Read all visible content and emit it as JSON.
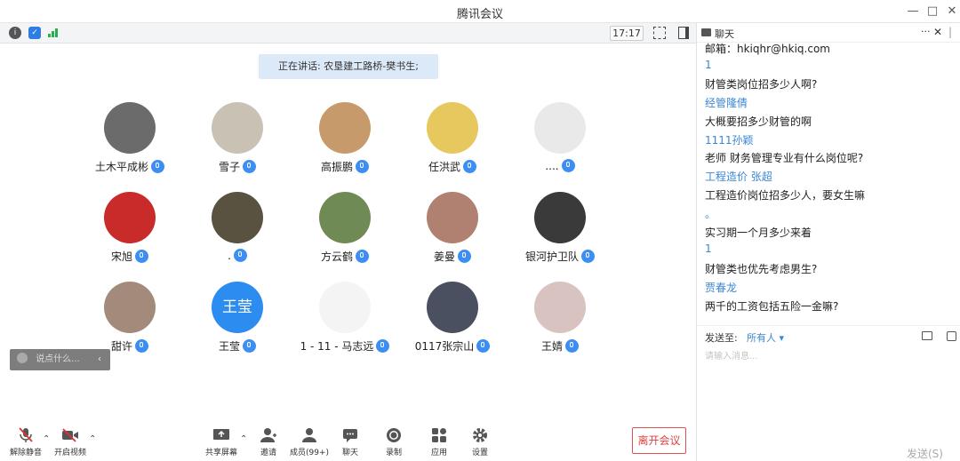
{
  "window": {
    "title": "腾讯会议",
    "min": "—",
    "max": "□",
    "close": "✕"
  },
  "toolbar": {
    "time": "17:17",
    "info_icon": "info-icon",
    "shield_icon": "shield-icon",
    "signal_icon": "signal-icon"
  },
  "speaking": "正在讲话: 农垦建工路桥-樊书生;",
  "participants": [
    {
      "name": "土木平成彬",
      "color": "#6b6b6b"
    },
    {
      "name": "雪子",
      "color": "#c9c2b4"
    },
    {
      "name": "高振鹏",
      "color": "#c69a6a"
    },
    {
      "name": "任洪武",
      "color": "#e7c85e"
    },
    {
      "name": "....",
      "color": "#e9e9e9"
    },
    {
      "name": "宋旭",
      "color": "#c92a2a"
    },
    {
      "name": ".",
      "color": "#5a5240"
    },
    {
      "name": "方云鹤",
      "color": "#6f8a55"
    },
    {
      "name": "姜曼",
      "color": "#b08070"
    },
    {
      "name": "银河护卫队",
      "color": "#3a3a3a"
    },
    {
      "name": "甜许",
      "color": "#a38a7a"
    },
    {
      "name": "王莹",
      "color": "#2d8cf0",
      "initials": "王莹"
    },
    {
      "name": "1 - 11 - 马志远",
      "color": "#f4f4f4"
    },
    {
      "name": "0117张宗山",
      "color": "#4a5060"
    },
    {
      "name": "王婧",
      "color": "#d9c3c0"
    }
  ],
  "saybox": {
    "placeholder": "说点什么...",
    "arrow": "‹"
  },
  "bottom": {
    "unmute": "解除静音",
    "video": "开启视频",
    "share": "共享屏幕",
    "invite": "邀请",
    "members": "成员(99+)",
    "chat": "聊天",
    "record": "录制",
    "apps": "应用",
    "settings": "设置",
    "leave": "离开会议"
  },
  "chat": {
    "title": "聊天",
    "more": "···",
    "close": "✕",
    "messages": [
      {
        "kind": "body",
        "text": "邮箱：hkiqhr@hkiq.com"
      },
      {
        "kind": "sender",
        "text": "1"
      },
      {
        "kind": "body",
        "text": "财管类岗位招多少人啊?"
      },
      {
        "kind": "sender",
        "text": "经管隆倩"
      },
      {
        "kind": "body",
        "text": "大概要招多少财管的啊"
      },
      {
        "kind": "sender",
        "text": "1111孙颖"
      },
      {
        "kind": "body",
        "text": "老师  财务管理专业有什么岗位呢?"
      },
      {
        "kind": "sender",
        "text": "工程造价 张超"
      },
      {
        "kind": "body",
        "text": "工程造价岗位招多少人，要女生嘛"
      },
      {
        "kind": "sender",
        "text": "。"
      },
      {
        "kind": "body",
        "text": "实习期一个月多少来着"
      },
      {
        "kind": "sender",
        "text": "1"
      },
      {
        "kind": "body",
        "text": "财管类也优先考虑男生?"
      },
      {
        "kind": "sender",
        "text": "贾春龙"
      },
      {
        "kind": "body",
        "text": "两千的工资包括五险一金嘛?"
      }
    ],
    "send_to_label": "发送至:",
    "send_to_value": "所有人 ▾",
    "input_placeholder": "请输入消息...",
    "send_button": "发送(S)"
  }
}
